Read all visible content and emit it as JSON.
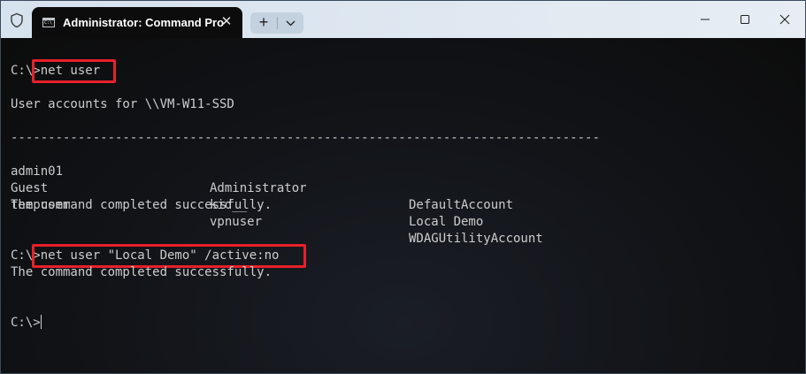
{
  "window": {
    "tab_title": "Administrator: Command Pro",
    "tab_icon_text": "C:\\",
    "close_glyph": "✕",
    "newtab_glyph": "+",
    "minimize_glyph": "—",
    "maximize_glyph": "☐",
    "window_close_glyph": "✕"
  },
  "terminal": {
    "prompt1": "C:\\>",
    "cmd1": "net user",
    "accounts_header": "User accounts for \\\\VM-W11-SSD",
    "divider": "-------------------------------------------------------------------------------",
    "accounts": [
      [
        "admin01",
        "Administrator",
        "DefaultAccount"
      ],
      [
        "Guest",
        "kid__",
        "Local Demo"
      ],
      [
        "tempuser",
        "vpnuser",
        "WDAGUtilityAccount"
      ]
    ],
    "success1": "The command completed successfully.",
    "prompt2": "C:\\>",
    "cmd2": "net user \"Local Demo\" /active:no",
    "success2": "The command completed successfully.",
    "prompt3": "C:\\>"
  },
  "colors": {
    "highlight": "#e8202a",
    "terminal_text": "#cccccc",
    "terminal_bg": "#0c0c0c"
  }
}
